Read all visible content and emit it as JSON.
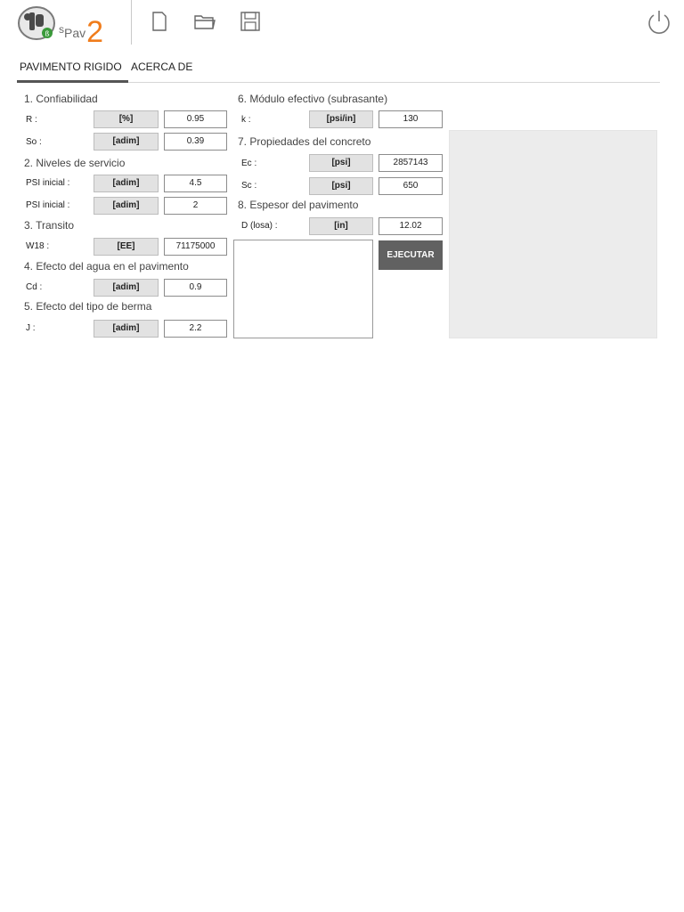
{
  "header": {
    "logo": {
      "pre": "s",
      "name": "Pav",
      "version": "2"
    },
    "icons": [
      "new-document-icon",
      "open-folder-icon",
      "save-icon",
      "power-icon"
    ]
  },
  "tabs": [
    {
      "label": "PAVIMENTO RIGIDO",
      "active": true
    },
    {
      "label": "ACERCA DE",
      "active": false
    }
  ],
  "sections": {
    "s1": "1. Confiabilidad",
    "s2": "2. Niveles de servicio",
    "s3": "3. Transito",
    "s4": "4. Efecto del agua en el pavimento",
    "s5": "5. Efecto del tipo de berma",
    "s6": "6. Módulo efectivo (subrasante)",
    "s7": "7. Propiedades del concreto",
    "s8": "8. Espesor del pavimento"
  },
  "fields": {
    "R": {
      "label": "R :",
      "unit": "[%]",
      "value": "0.95"
    },
    "So": {
      "label": "So :",
      "unit": "[adim]",
      "value": "0.39"
    },
    "PSIi": {
      "label": "PSI inicial :",
      "unit": "[adim]",
      "value": "4.5"
    },
    "PSIf": {
      "label": "PSI inicial :",
      "unit": "[adim]",
      "value": "2"
    },
    "W18": {
      "label": "W18 :",
      "unit": "[EE]",
      "value": "71175000"
    },
    "Cd": {
      "label": "Cd :",
      "unit": "[adim]",
      "value": "0.9"
    },
    "J": {
      "label": "J :",
      "unit": "[adim]",
      "value": "2.2"
    },
    "k": {
      "label": "k :",
      "unit": "[psi/in]",
      "value": "130"
    },
    "Ec": {
      "label": "Ec :",
      "unit": "[psi]",
      "value": "2857143"
    },
    "Sc": {
      "label": "Sc :",
      "unit": "[psi]",
      "value": "650"
    },
    "D": {
      "label": "D (losa) :",
      "unit": "[in]",
      "value": "12.02"
    }
  },
  "execute_label": "EJECUTAR",
  "colors": {
    "accent": "#f07c1b",
    "button": "#616161",
    "panel": "#ececec"
  }
}
